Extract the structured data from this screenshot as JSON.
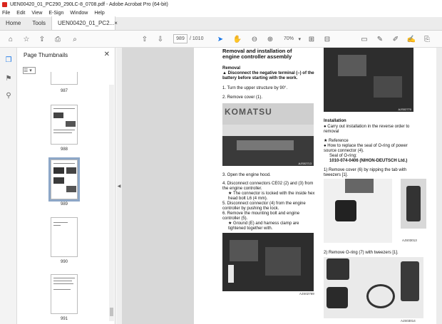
{
  "window": {
    "title": "UEN00420_01_PC290_290LC-8_0708.pdf - Adobe Acrobat Pro (64-bit)"
  },
  "menu": [
    "File",
    "Edit",
    "View",
    "E-Sign",
    "Window",
    "Help"
  ],
  "tabs": {
    "home": "Home",
    "tools": "Tools",
    "doc": "UEN00420_01_PC2...",
    "doc_close": "×"
  },
  "toolbar": {
    "page_current": "989",
    "page_count": "/ 1010",
    "zoom": "70%",
    "icons": [
      "star-icon",
      "upload-icon",
      "print-icon",
      "search-icon",
      "up-icon",
      "down-icon",
      "cursor-icon",
      "hand-icon",
      "zoom-out-icon",
      "zoom-in-icon",
      "fit-icon",
      "comment-icon",
      "pen-icon",
      "highlight-icon",
      "sign-icon",
      "share-icon"
    ]
  },
  "panel": {
    "title": "Page Thumbnails",
    "close": "✕",
    "options": "☰ ▾",
    "thumbs": [
      "987",
      "988",
      "989",
      "990",
      "991"
    ]
  },
  "document": {
    "heading_line1": "Removal and installation of",
    "heading_line2": "engine controller assembly",
    "removal": "Removal",
    "warning": "▲ Disconnect the negative terminal (–) of the battery before starting with the work.",
    "step1": "1.  Turn the upper structure by 90°.",
    "step2": "2.  Remove cover (1).",
    "step3": "3.  Open the engine hood.",
    "step4": "4.  Disconnect connectors CE02 (2) and (3) from the engine controller.",
    "step4_note": "★ The connector is locked with the inside hex head bolt L6 (4 mm).",
    "step5": "5.  Disconnect connector (4) from the engine controller by pushing the lock.",
    "step6": "6.  Remove the mounting bolt and engine controller (5).",
    "step6_note": "★ Ground (E) and harness clamp are tightened together with.",
    "fig1_cap": "AJS02713",
    "fig2_cap": "AJS02769",
    "fig3_cap": "AJS02770",
    "installation": "Installation",
    "inst_bullet": "●  Carry out installation in the reverse order to removal",
    "reference": "★  Reference",
    "ref_text": "●  How to replace the seal of O-ring of power source connector (4).",
    "seal_label": "Seal of O-ring:",
    "seal_part": "1010-074-0406 (NIHON-DEUTSCH Ltd.)",
    "sub1": "1)  Remove cover (6) by nipping the tab with tweezers [1].",
    "sub2": "2)  Remove O-ring (7) with tweezers [1].",
    "fig4_cap": "AJS03013",
    "fig5_cap": "AJS03014",
    "komatsu": "KOMATSU"
  }
}
